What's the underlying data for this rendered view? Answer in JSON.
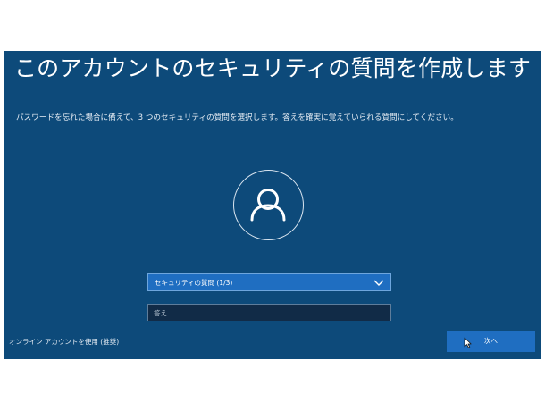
{
  "page": {
    "title": "このアカウントのセキュリティの質問を作成します",
    "subtitle": "パスワードを忘れた場合に備えて、3 つのセキュリティの質問を選択します。答えを確実に覚えていられる質問にしてください。"
  },
  "icons": {
    "avatar": "user-silhouette-icon",
    "dropdown": "chevron-down-icon",
    "cursor": "mouse-pointer-icon"
  },
  "form": {
    "question_select": {
      "selected": "セキュリティの質問 (1/3)"
    },
    "answer_field": {
      "placeholder": "答え",
      "value": ""
    }
  },
  "footer": {
    "online_account_link": "オンライン アカウントを使用 (推奨)",
    "next_label": "次へ"
  },
  "colors": {
    "background": "#0d4a7a",
    "accent": "#1f6ec1",
    "input_background": "#112b47"
  }
}
